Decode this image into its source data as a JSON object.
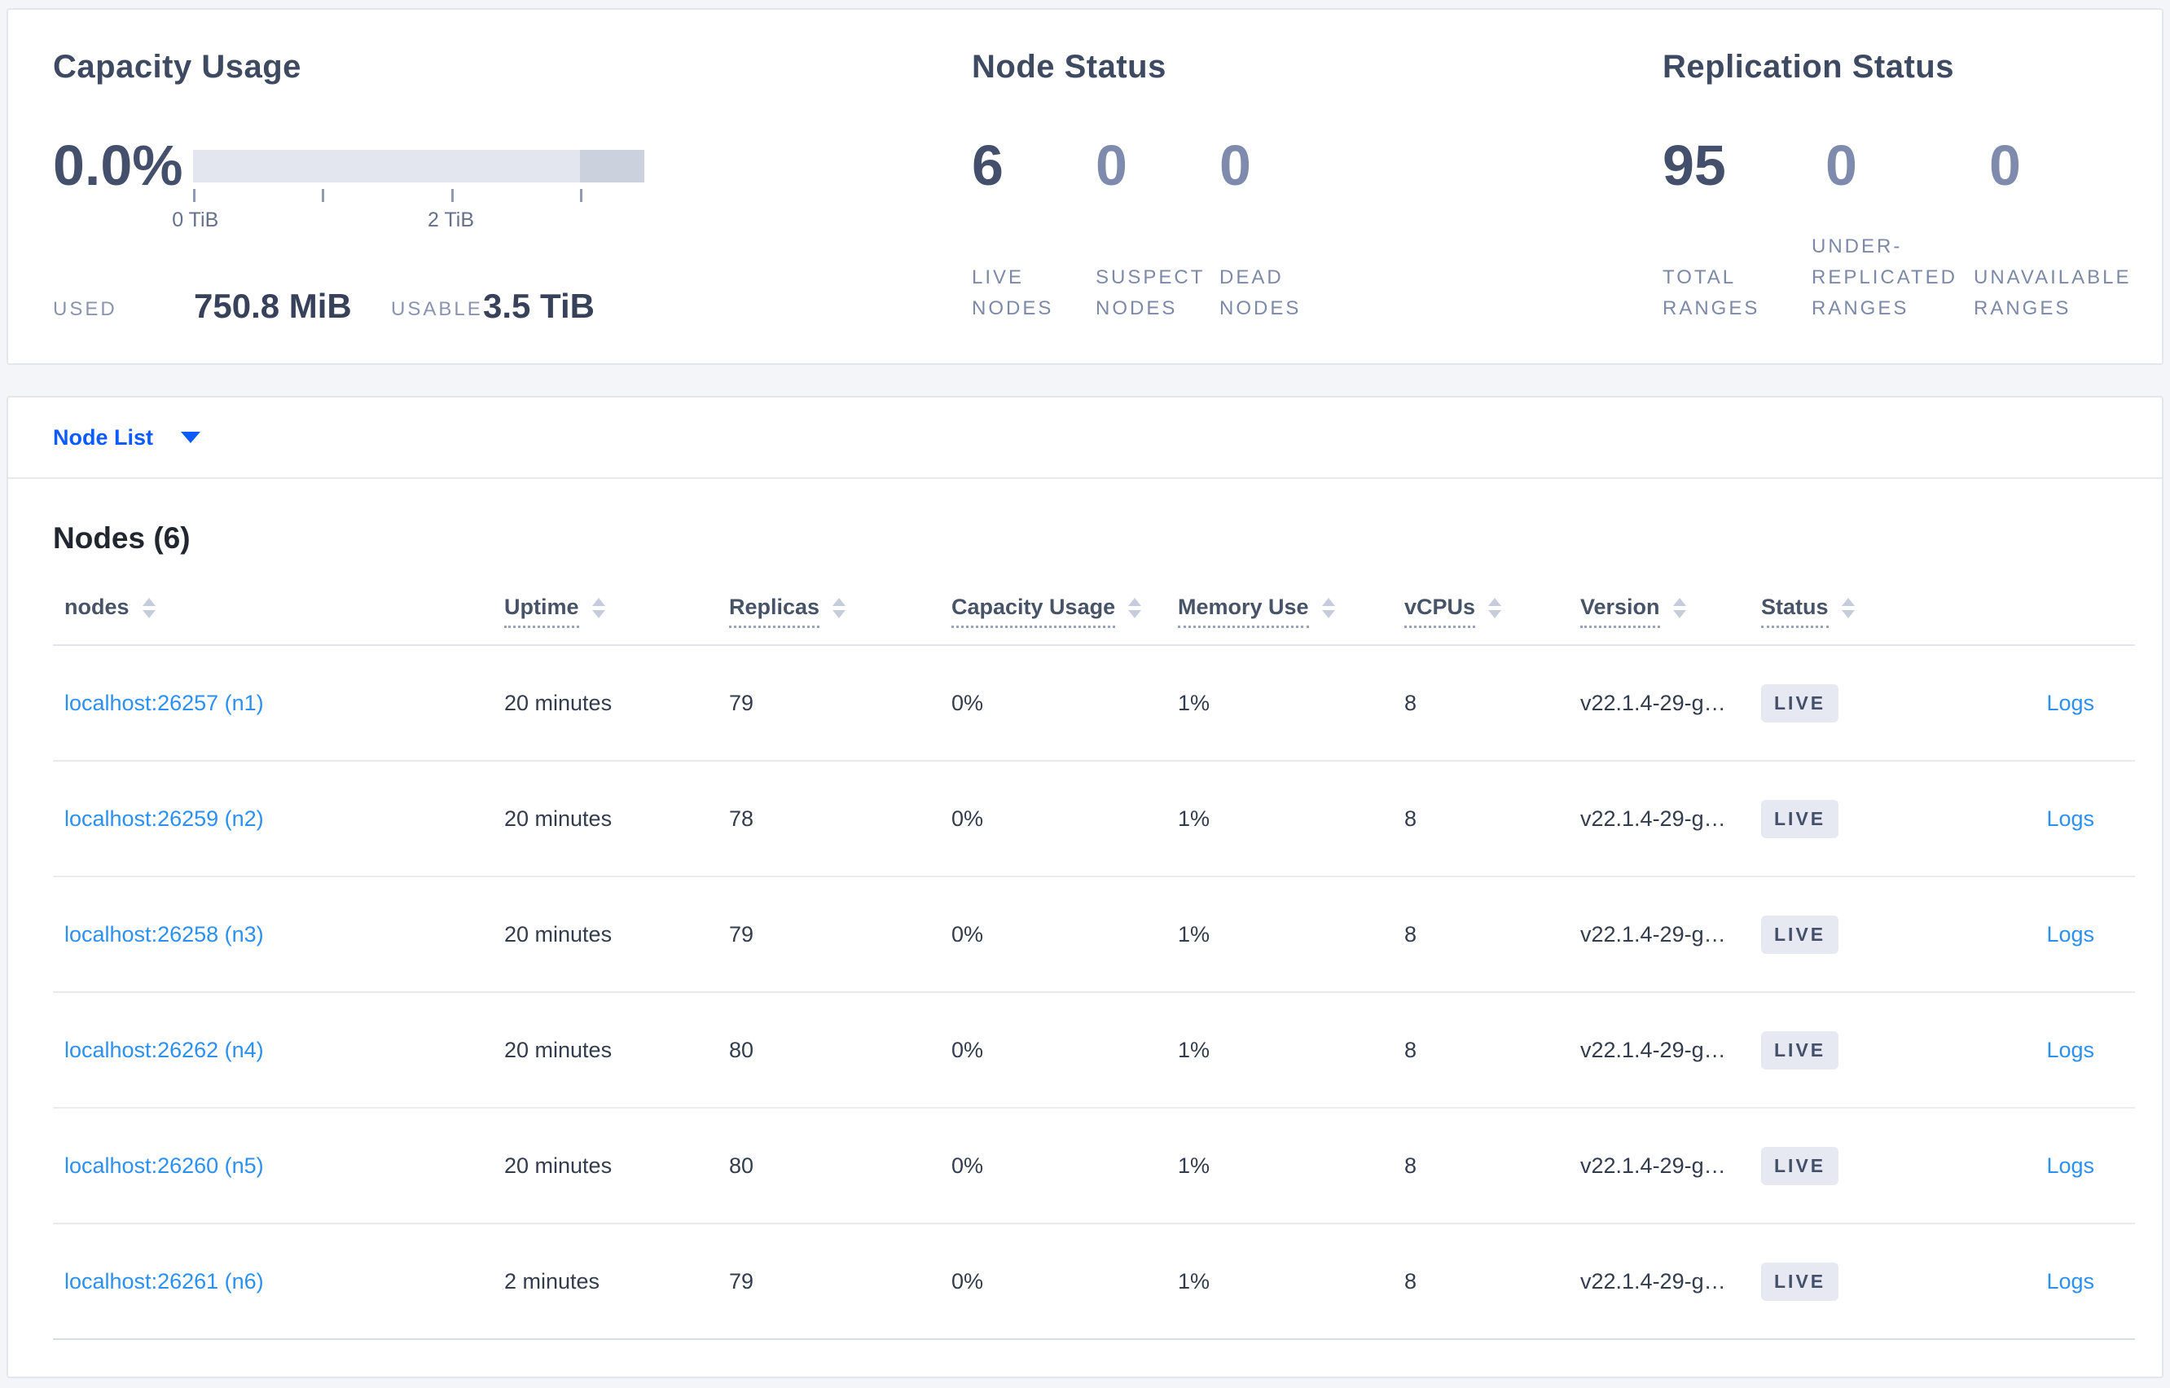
{
  "colors": {
    "accent_blue": "#0b5bff",
    "link_blue": "#2b90f0",
    "dark_slate": "#44506b",
    "muted_slate": "#7e8bac",
    "badge_bg": "#e6e9f1",
    "bar_fill": "#e3e6ee",
    "bar_tail": "#ccd1de"
  },
  "summary": {
    "capacity": {
      "title": "Capacity Usage",
      "percent": "0.0%",
      "axis": {
        "tick0": "0 TiB",
        "tick2": "2 TiB"
      },
      "used_label": "USED",
      "used_value": "750.8 MiB",
      "usable_label": "USABLE",
      "usable_value": "3.5 TiB"
    },
    "node_status": {
      "title": "Node Status",
      "stats": [
        {
          "value": "6",
          "label": "LIVE\nNODES"
        },
        {
          "value": "0",
          "label": "SUSPECT\nNODES"
        },
        {
          "value": "0",
          "label": "DEAD\nNODES"
        }
      ]
    },
    "replication": {
      "title": "Replication Status",
      "stats": [
        {
          "value": "95",
          "label": "TOTAL\nRANGES"
        },
        {
          "value": "0",
          "label": "UNDER-\nREPLICATED\nRANGES"
        },
        {
          "value": "0",
          "label": "UNAVAILABLE\nRANGES"
        }
      ]
    }
  },
  "node_list_dropdown": {
    "label": "Node List"
  },
  "nodes": {
    "heading": "Nodes (6)",
    "columns": {
      "nodes": "nodes",
      "uptime": "Uptime",
      "replicas": "Replicas",
      "capacity": "Capacity Usage",
      "memory": "Memory Use",
      "vcpus": "vCPUs",
      "version": "Version",
      "status": "Status"
    },
    "rows": [
      {
        "name": "localhost:26257 (n1)",
        "uptime": "20 minutes",
        "replicas": "79",
        "capacity": "0%",
        "memory": "1%",
        "vcpus": "8",
        "version": "v22.1.4-29-g…",
        "status": "LIVE",
        "logs": "Logs"
      },
      {
        "name": "localhost:26259 (n2)",
        "uptime": "20 minutes",
        "replicas": "78",
        "capacity": "0%",
        "memory": "1%",
        "vcpus": "8",
        "version": "v22.1.4-29-g…",
        "status": "LIVE",
        "logs": "Logs"
      },
      {
        "name": "localhost:26258 (n3)",
        "uptime": "20 minutes",
        "replicas": "79",
        "capacity": "0%",
        "memory": "1%",
        "vcpus": "8",
        "version": "v22.1.4-29-g…",
        "status": "LIVE",
        "logs": "Logs"
      },
      {
        "name": "localhost:26262 (n4)",
        "uptime": "20 minutes",
        "replicas": "80",
        "capacity": "0%",
        "memory": "1%",
        "vcpus": "8",
        "version": "v22.1.4-29-g…",
        "status": "LIVE",
        "logs": "Logs"
      },
      {
        "name": "localhost:26260 (n5)",
        "uptime": "20 minutes",
        "replicas": "80",
        "capacity": "0%",
        "memory": "1%",
        "vcpus": "8",
        "version": "v22.1.4-29-g…",
        "status": "LIVE",
        "logs": "Logs"
      },
      {
        "name": "localhost:26261 (n6)",
        "uptime": "2 minutes",
        "replicas": "79",
        "capacity": "0%",
        "memory": "1%",
        "vcpus": "8",
        "version": "v22.1.4-29-g…",
        "status": "LIVE",
        "logs": "Logs"
      }
    ]
  }
}
